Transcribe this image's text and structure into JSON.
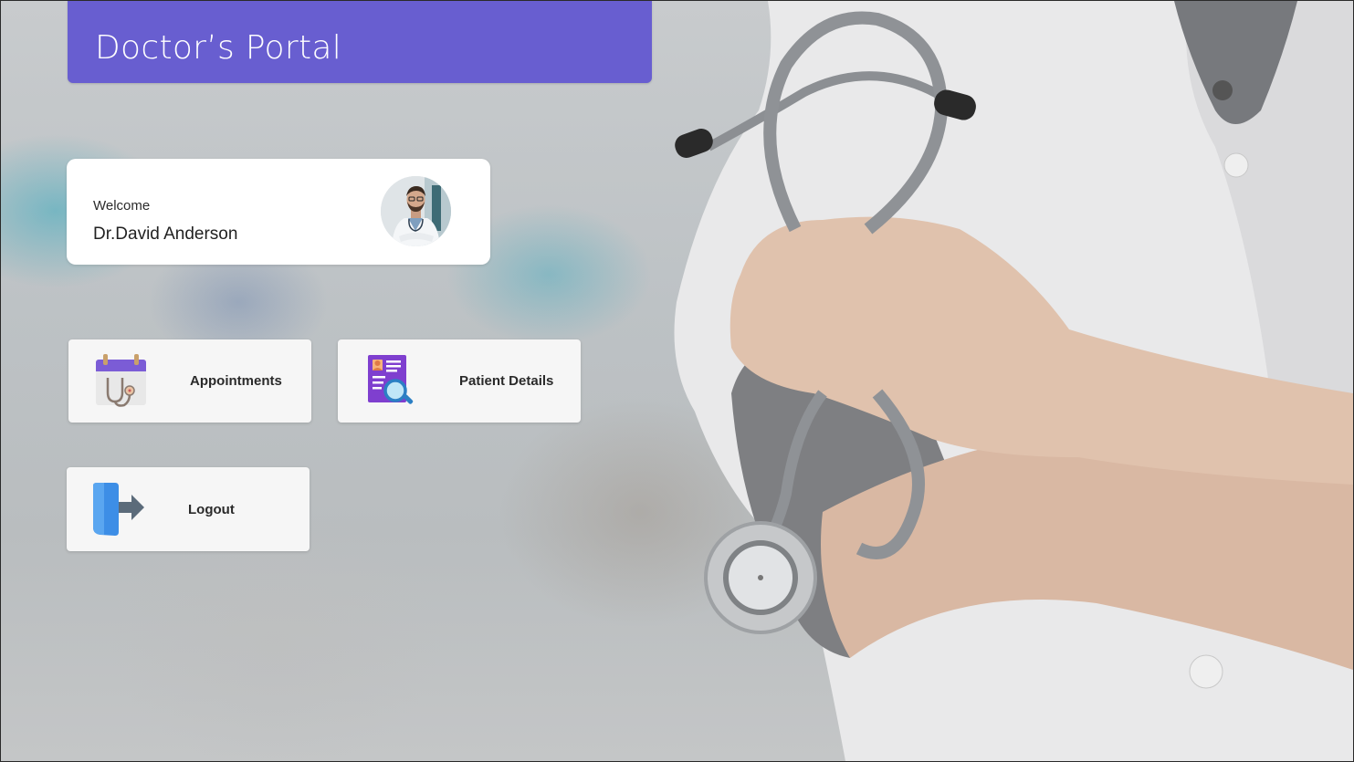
{
  "header": {
    "title": "Doctor’s Portal",
    "color": "#685ed0"
  },
  "welcome": {
    "greeting": "Welcome",
    "doctor_name": "Dr.David Anderson",
    "avatar_icon": "doctor-avatar"
  },
  "tiles": [
    {
      "label": "Appointments",
      "icon": "calendar-stethoscope-icon"
    },
    {
      "label": "Patient Details",
      "icon": "patient-record-search-icon"
    },
    {
      "label": "Logout",
      "icon": "logout-door-arrow-icon"
    }
  ],
  "colors": {
    "accent": "#685ed0",
    "card_bg": "#ffffff",
    "tile_bg": "#f6f6f6"
  }
}
